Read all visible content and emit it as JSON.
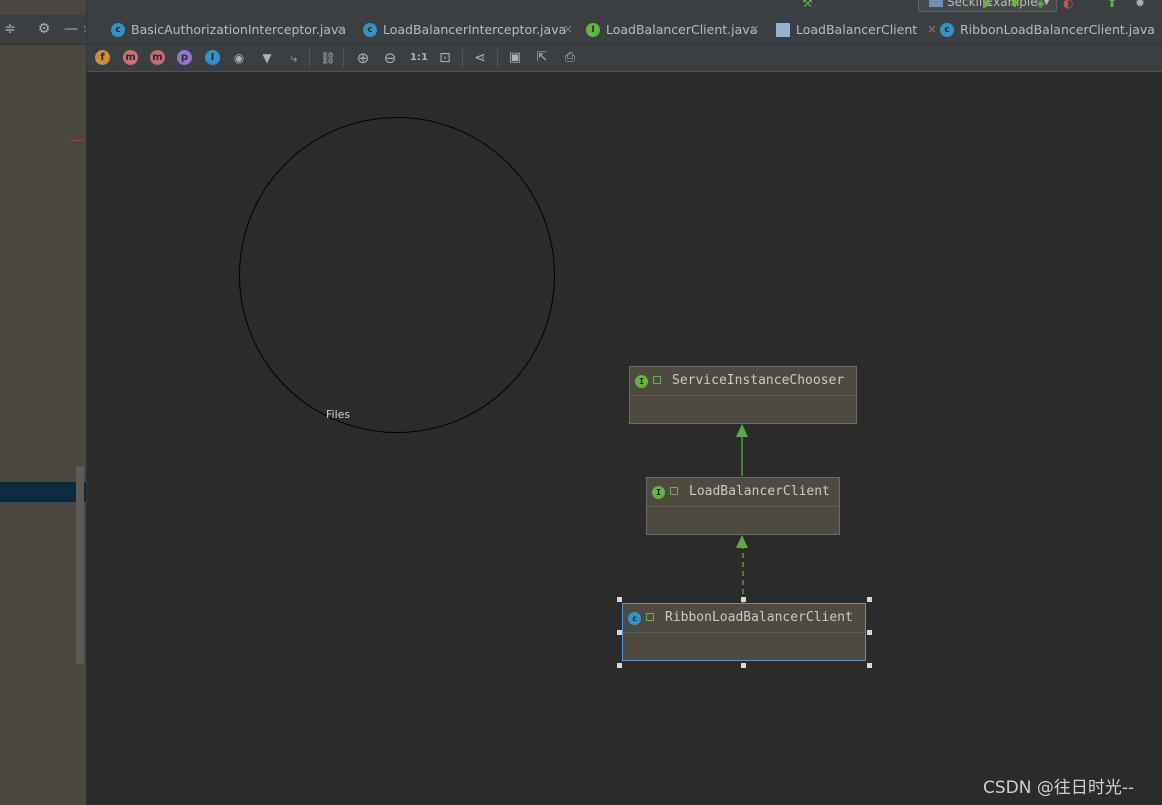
{
  "run_bar": {
    "config_name": "SeckillExample",
    "icons": [
      "build-icon",
      "run-icon",
      "debug-icon",
      "coverage-icon",
      "profile-icon",
      "attach-icon",
      "bug-icon"
    ]
  },
  "left_panel": {
    "icons": [
      "collapse-icon",
      "settings-gear-icon",
      "hide-icon"
    ],
    "tab_close": "×"
  },
  "tabs": [
    {
      "label": "BasicAuthorizationInterceptor.java",
      "icon": "class-icon",
      "icon_letter": "c",
      "icon_color": "#3592c4",
      "close": "×"
    },
    {
      "label": "LoadBalancerInterceptor.java",
      "icon": "class-icon",
      "icon_letter": "c",
      "icon_color": "#3592c4",
      "close": "×"
    },
    {
      "label": "LoadBalancerClient.java",
      "icon": "interface-icon",
      "icon_letter": "I",
      "icon_color": "#62b543",
      "close": "×"
    },
    {
      "label": "LoadBalancerClient",
      "icon": "diagram-icon",
      "icon_letter": "",
      "icon_color": "#8fb5d6",
      "close": "×"
    },
    {
      "label": "RibbonLoadBalancerClient.java",
      "icon": "class-icon",
      "icon_letter": "c",
      "icon_color": "#3592c4",
      "close": ""
    }
  ],
  "toolbar": {
    "items": [
      {
        "name": "fields-toggle-icon",
        "glyph": "f",
        "color": "#d18d38"
      },
      {
        "name": "constructors-toggle-icon",
        "glyph": "m",
        "color": "#d0706e"
      },
      {
        "name": "methods-toggle-icon",
        "glyph": "m",
        "color": "#c56a78"
      },
      {
        "name": "properties-toggle-icon",
        "glyph": "p",
        "color": "#9475c9"
      },
      {
        "name": "inner-classes-toggle-icon",
        "glyph": "I",
        "color": "#3592c4"
      },
      {
        "name": "visibility-eye-icon",
        "glyph": "◉",
        "color": ""
      },
      {
        "name": "filter-icon",
        "glyph": "▼",
        "color": ""
      },
      {
        "name": "route-edges-icon",
        "glyph": "⤷",
        "color": ""
      },
      {
        "name": "link-icon",
        "glyph": "⛓",
        "color": ""
      },
      {
        "name": "zoom-in-icon",
        "glyph": "⊕",
        "color": ""
      },
      {
        "name": "zoom-out-icon",
        "glyph": "⊖",
        "color": ""
      },
      {
        "name": "actual-size-icon",
        "glyph": "1:1",
        "color": ""
      },
      {
        "name": "fit-content-icon",
        "glyph": "⊡",
        "color": ""
      },
      {
        "name": "layout-icon",
        "glyph": "⋖",
        "color": ""
      },
      {
        "name": "save-icon",
        "glyph": "▣",
        "color": ""
      },
      {
        "name": "export-icon",
        "glyph": "⇱",
        "color": ""
      },
      {
        "name": "print-icon",
        "glyph": "⎙",
        "color": ""
      }
    ]
  },
  "diagram": {
    "circle_label": "Files",
    "nodes": [
      {
        "id": "service-instance-chooser",
        "label": "ServiceInstanceChooser",
        "kind": "interface",
        "icon_letter": "I",
        "icon_color": "#62b543"
      },
      {
        "id": "load-balancer-client",
        "label": "LoadBalancerClient",
        "kind": "interface",
        "icon_letter": "I",
        "icon_color": "#62b543"
      },
      {
        "id": "ribbon-load-balancer-client",
        "label": "RibbonLoadBalancerClient",
        "kind": "class",
        "icon_letter": "c",
        "icon_color": "#3592c4",
        "selected": true
      }
    ],
    "edges": [
      {
        "from": "load-balancer-client",
        "to": "service-instance-chooser",
        "style": "solid"
      },
      {
        "from": "ribbon-load-balancer-client",
        "to": "load-balancer-client",
        "style": "dashed"
      }
    ],
    "edge_color": "#5fa84a"
  },
  "watermark": "CSDN @往日时光--"
}
